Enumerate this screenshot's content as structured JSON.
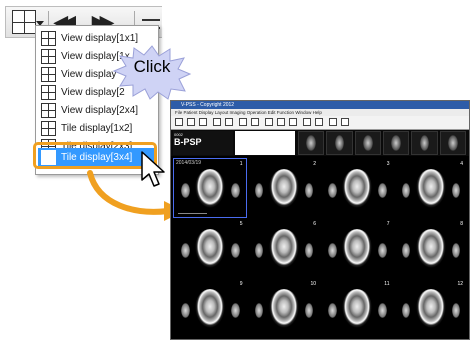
{
  "menu": {
    "items": [
      {
        "label": "View display[1x1]",
        "selected": false
      },
      {
        "label": "View display[1x2]",
        "selected": false
      },
      {
        "label": "View display[2x2]",
        "selected": false
      },
      {
        "label": "View display[2x3]",
        "selected": false
      },
      {
        "label": "View display[2x4]",
        "selected": false
      },
      {
        "label": "Tile display[1x2]",
        "selected": false
      },
      {
        "label": "Tile display[2x3]",
        "selected": false
      },
      {
        "label": "Tile display[3x4]",
        "selected": true
      }
    ],
    "item_0": "View display[1x1]",
    "item_1": "View display[1x",
    "item_2": "View display",
    "item_3": "View display[2",
    "item_4": "View display[2x4]",
    "item_5": "Tile display[1x2]",
    "item_6": "Tile display[2x3]",
    "item_7": "Tile display[3x4]"
  },
  "callout": {
    "click_label": "Click"
  },
  "colors": {
    "highlight": "#f0a020",
    "selection": "#3399ff",
    "arrow": "#f0a020",
    "active_tile": "#4a6cf0"
  },
  "icons": [
    "grid-layout-icon",
    "dropdown-arrow-icon",
    "prev-icon",
    "next-icon",
    "cursor-icon"
  ],
  "app": {
    "title": "V-PSS - Copyright 2012",
    "menubar": "File   Patient   Display   Layout   Imaging   Operation   Edit   Function   Window   Help",
    "patient_id": "0002",
    "patient_name": "B-PSP",
    "tile_date": "2014/03/19",
    "tiles": [
      "1",
      "2",
      "3",
      "4",
      "5",
      "6",
      "7",
      "8",
      "9",
      "10",
      "11",
      "12"
    ]
  }
}
